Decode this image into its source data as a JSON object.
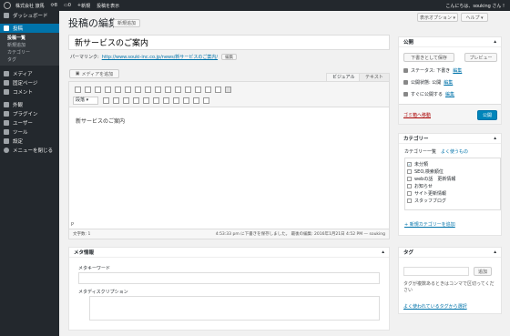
{
  "admin_bar": {
    "site_name": "株式会社 旅馬",
    "updates_count": "8",
    "comments_count": "0",
    "new_label": "新規",
    "view_post_label": "投稿を表示",
    "greeting": "こんにちは、souking さん !"
  },
  "sidebar": {
    "dashboard": "ダッシュボード",
    "posts": "投稿",
    "posts_sub": [
      "投稿一覧",
      "新規追加",
      "カテゴリー",
      "タグ"
    ],
    "items": [
      "メディア",
      "固定ページ",
      "コメント"
    ],
    "items2": [
      "外観",
      "プラグイン",
      "ユーザー",
      "ツール",
      "設定"
    ],
    "collapse": "メニューを閉じる"
  },
  "header": {
    "title": "投稿の編集",
    "add_new": "新規追加",
    "screen_options": "表示オプション ▾",
    "help": "ヘルプ ▾"
  },
  "post": {
    "title_value": "新サービスのご案内",
    "permalink_label": "パーマリンク:",
    "permalink_url": "http://www.souki-inc.co.jp/news/新サービスのご案内/",
    "permalink_edit": "編集",
    "add_media": "メディアを追加",
    "tab_visual": "ビジュアル",
    "tab_text": "テキスト",
    "format": "段落",
    "content": "新サービスのご案内",
    "path": "P",
    "word_count": "文字数: 1",
    "last_edit": "4:53:33 pm に下書きを保存しました。 最後の編集: 2016年1月21日 4:52 PM — souking"
  },
  "meta_box": {
    "title": "メタ情報",
    "keyword_label": "メタキーワード",
    "description_label": "メタディスクリプション"
  },
  "publish": {
    "title": "公開",
    "save_draft": "下書きとして保存",
    "preview": "プレビュー",
    "status_label": "ステータス: 下書き",
    "status_edit": "編集",
    "visibility_label": "公開状態: 公開",
    "visibility_edit": "編集",
    "schedule_label": "すぐに公開する",
    "schedule_edit": "編集",
    "trash": "ゴミ箱へ移動",
    "publish_button": "公開"
  },
  "categories": {
    "title": "カテゴリー",
    "tab_all": "カテゴリー一覧",
    "tab_popular": "よく使うもの",
    "items": [
      {
        "label": "未分類",
        "checked": true,
        "child": false
      },
      {
        "label": "SEO,検索順位",
        "checked": false,
        "child": false
      },
      {
        "label": "webの話　更新情報",
        "checked": false,
        "child": false
      },
      {
        "label": "お知らせ",
        "checked": false,
        "child": false
      },
      {
        "label": "サイト更新情報",
        "checked": false,
        "child": false
      },
      {
        "label": "スタッフブログ",
        "checked": false,
        "child": false
      }
    ],
    "add_new": "+ 新規カテゴリーを追加"
  },
  "tags": {
    "title": "タグ",
    "add_button": "追加",
    "hint": "タグが複数あるときはコンマで区切ってください",
    "popular_link": "よく使われているタグから選択"
  }
}
